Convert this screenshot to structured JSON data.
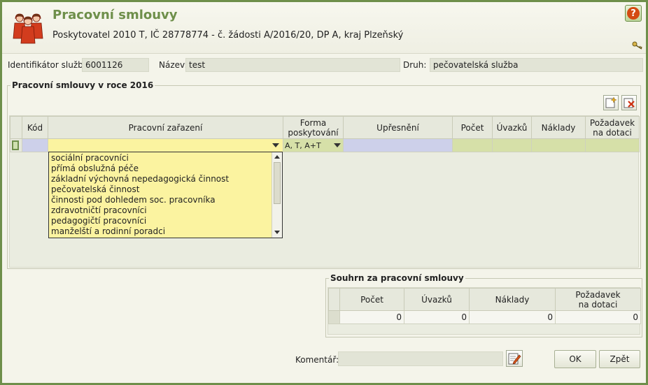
{
  "header": {
    "title": "Pracovní smlouvy",
    "subtitle": "Poskytovatel 2010 T, IČ 28778774 - č. žádosti A/2016/20, DP A, kraj Plzeňský",
    "help_symbol": "?"
  },
  "info": {
    "id_label": "Identifikátor služby:",
    "id_value": "6001126",
    "name_label": "Název:",
    "name_value": "test",
    "type_label": "Druh:",
    "type_value": "pečovatelská služba"
  },
  "contracts": {
    "legend": "Pracovní smlouvy v roce 2016",
    "columns": {
      "code": "Kód",
      "position": "Pracovní zařazení",
      "form_line1": "Forma",
      "form_line2": "poskytování",
      "spec": "Upřesnění",
      "count": "Počet",
      "fte": "Úvazků",
      "costs": "Náklady",
      "req_line1": "Požadavek",
      "req_line2": "na dotaci"
    },
    "row": {
      "code": "",
      "position": "",
      "form": "A, T, A+T",
      "spec": "",
      "count": "",
      "fte": "",
      "costs": "",
      "request": ""
    },
    "dropdown_options": [
      "sociální pracovníci",
      "přímá obslužná péče",
      "základní výchovná nepedagogická činnost",
      "pečovatelská činnost",
      "činnosti pod dohledem soc. pracovníka",
      "zdravotničtí pracovníci",
      "pedagogičtí pracovníci",
      "manželští a rodinní poradci"
    ]
  },
  "summary": {
    "legend": "Souhrn za pracovní smlouvy",
    "columns": {
      "count": "Počet",
      "fte": "Úvazků",
      "costs": "Náklady",
      "req_line1": "Požadavek",
      "req_line2": "na dotaci"
    },
    "values": {
      "count": "0",
      "fte": "0",
      "costs": "0",
      "request": "0"
    }
  },
  "footer": {
    "comment_label": "Komentář:",
    "comment_value": "",
    "ok_label": "OK",
    "back_label": "Zpět"
  },
  "colors": {
    "accent": "#6e8f4a",
    "row_code": "#cdd0ea",
    "row_select": "#fbf3a0",
    "row_cells": "#d6e0a8"
  }
}
